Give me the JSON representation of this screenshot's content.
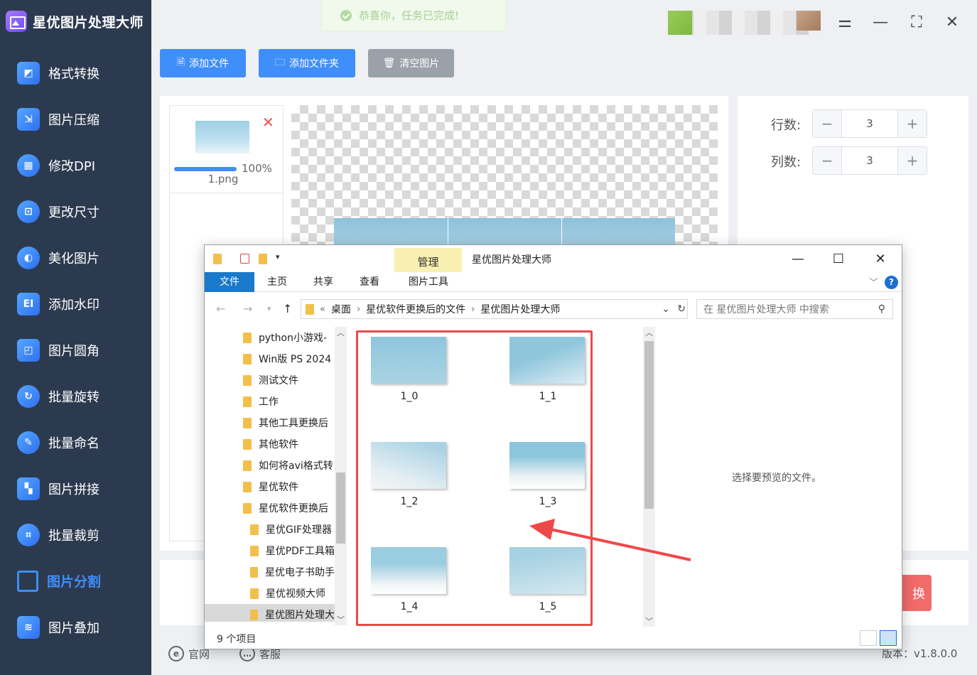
{
  "app": {
    "title": "星优图片处理大师",
    "version": "版本：v1.8.0.0"
  },
  "sidebar": {
    "items": [
      {
        "label": "格式转换",
        "icon": "image-convert-icon"
      },
      {
        "label": "图片压缩",
        "icon": "image-compress-icon"
      },
      {
        "label": "修改DPI",
        "icon": "dpi-icon"
      },
      {
        "label": "更改尺寸",
        "icon": "resize-icon"
      },
      {
        "label": "美化图片",
        "icon": "beautify-icon"
      },
      {
        "label": "添加水印",
        "icon": "watermark-icon"
      },
      {
        "label": "图片圆角",
        "icon": "round-corner-icon"
      },
      {
        "label": "批量旋转",
        "icon": "rotate-icon"
      },
      {
        "label": "批量命名",
        "icon": "rename-icon"
      },
      {
        "label": "图片拼接",
        "icon": "stitch-icon"
      },
      {
        "label": "批量裁剪",
        "icon": "crop-icon"
      },
      {
        "label": "图片分割",
        "icon": "split-icon",
        "active": true
      },
      {
        "label": "图片叠加",
        "icon": "layers-icon"
      }
    ]
  },
  "toast": {
    "text": "恭喜你，任务已完成!"
  },
  "toolbar": {
    "add_file": "添加文件",
    "add_folder": "添加文件夹",
    "clear": "清空图片"
  },
  "file_card": {
    "name": "1.png",
    "progress_label": "100%",
    "progress": 1.0
  },
  "settings": {
    "rows_label": "行数:",
    "rows_value": "3",
    "cols_label": "列数:",
    "cols_value": "3"
  },
  "convert_label": "换",
  "footer": {
    "website": "官网",
    "support": "客服"
  },
  "explorer": {
    "manage_tab": "管理",
    "window_title": "星优图片处理大师",
    "ribbon_tabs": [
      "文件",
      "主页",
      "共享",
      "查看",
      "图片工具"
    ],
    "address": {
      "prefix": "«",
      "segments": [
        "桌面",
        "星优软件更换后的文件",
        "星优图片处理大师"
      ]
    },
    "search_placeholder": "在 星优图片处理大师 中搜索",
    "tree": [
      {
        "label": "python小游戏-",
        "indent": 0
      },
      {
        "label": "Win版 PS 2024",
        "indent": 0
      },
      {
        "label": "测试文件",
        "indent": 0
      },
      {
        "label": "工作",
        "indent": 0
      },
      {
        "label": "其他工具更换后",
        "indent": 0
      },
      {
        "label": "其他软件",
        "indent": 0
      },
      {
        "label": "如何将avi格式转",
        "indent": 0
      },
      {
        "label": "星优软件",
        "indent": 0
      },
      {
        "label": "星优软件更换后",
        "indent": 0
      },
      {
        "label": "星优GIF处理器",
        "indent": 1
      },
      {
        "label": "星优PDF工具箱",
        "indent": 1
      },
      {
        "label": "星优电子书助手",
        "indent": 1
      },
      {
        "label": "星优视频大师",
        "indent": 1
      },
      {
        "label": "星优图片处理大",
        "indent": 1,
        "selected": true
      }
    ],
    "files": [
      "1_0",
      "1_1",
      "1_2",
      "1_3",
      "1_4",
      "1_5"
    ],
    "preview_message": "选择要预览的文件。",
    "status": "9 个项目"
  },
  "colors": {
    "accent": "#3f8ef9",
    "sidebar_bg": "#2c3a4f",
    "highlight_box": "#e94b4b",
    "convert_button": "#f36a6a"
  }
}
